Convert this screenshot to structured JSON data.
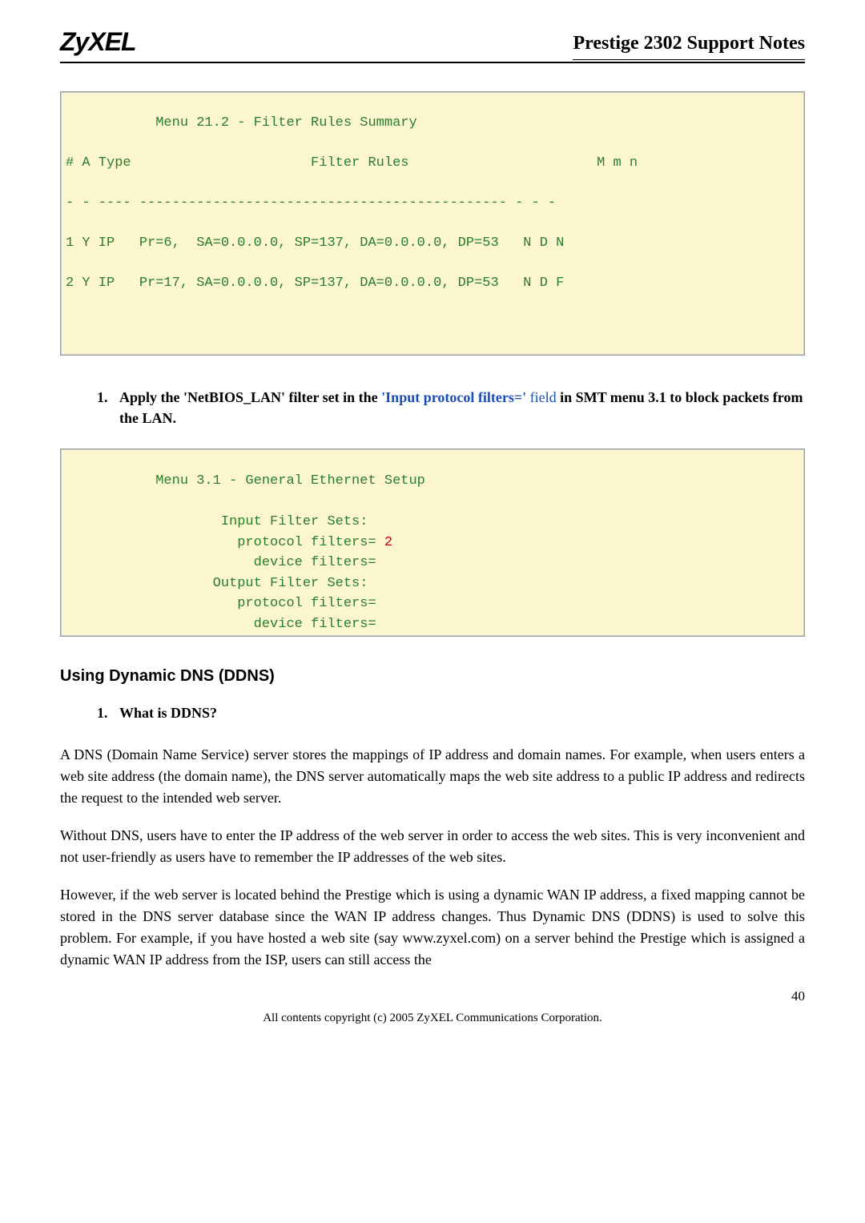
{
  "header": {
    "logo": "ZyXEL",
    "title": "Prestige 2302 Support Notes"
  },
  "code1": {
    "menu_title": "           Menu 21.2 - Filter Rules Summary",
    "cols": "# A Type                      Filter Rules                       M m n",
    "sep": "- - ---- --------------------------------------------- - - -",
    "rule1": "1 Y IP   Pr=6,  SA=0.0.0.0, SP=137, DA=0.0.0.0, DP=53   N D N",
    "rule2": "2 Y IP   Pr=17, SA=0.0.0.0, SP=137, DA=0.0.0.0, DP=53   N D F"
  },
  "apply_step": {
    "num": "1.",
    "t1": "Apply the 'NetBIOS_LAN' filter set in the ",
    "blue": "'Input protocol filters='",
    "tfield": " field",
    "t2": " in SMT menu 3.1 to block packets from the LAN."
  },
  "code2": {
    "title": "           Menu 3.1 - General Ethernet Setup",
    "l1": "                   Input Filter Sets:",
    "l2pre": "                     protocol filters= ",
    "l2val": "2",
    "l3": "                       device filters=",
    "l4": "                  Output Filter Sets:",
    "l5": "                     protocol filters=",
    "l6": "                       device filters="
  },
  "section_heading": "Using Dynamic DNS (DDNS)",
  "ddns_step": {
    "num": "1.",
    "text": "What is DDNS?"
  },
  "para1": "A DNS (Domain Name Service) server stores the mappings of IP address and domain names. For example, when users enters a web site address (the domain name), the DNS server automatically maps the web site address to a public IP address and redirects the request to the intended web server.",
  "para2": "Without DNS, users have to enter the IP address of the web server in order to access the web sites. This is very inconvenient and not user-friendly as users have to remember the IP addresses of the web sites.",
  "para3": "However, if the web server is located behind the Prestige which is using a dynamic WAN IP address, a fixed mapping cannot be stored in the DNS server database since the WAN IP address changes. Thus Dynamic DNS (DDNS) is used to solve this problem. For example, if you have hosted a web site (say www.zyxel.com) on a server behind the Prestige which is assigned a dynamic WAN IP address from the ISP, users can still access the",
  "page_number": "40",
  "copyright": "All contents copyright (c) 2005 ZyXEL Communications Corporation."
}
